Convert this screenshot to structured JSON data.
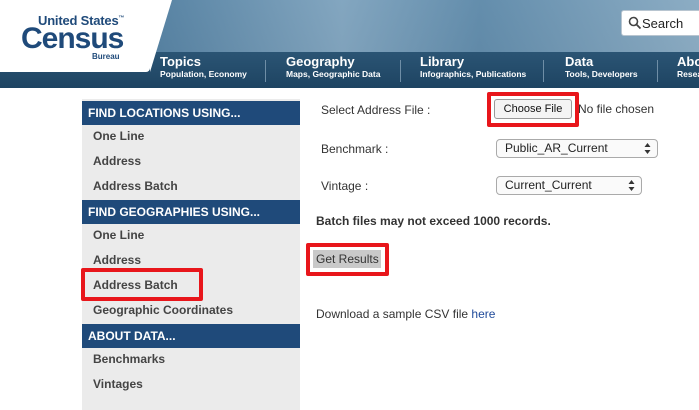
{
  "header": {
    "logo": {
      "line1": "United States",
      "tm": "™",
      "line2": "Census",
      "line3": "Bureau"
    },
    "search": {
      "label": "Search"
    },
    "nav": [
      {
        "title": "Topics",
        "sub": "Population, Economy"
      },
      {
        "title": "Geography",
        "sub": "Maps, Geographic Data"
      },
      {
        "title": "Library",
        "sub": "Infographics, Publications"
      },
      {
        "title": "Data",
        "sub": "Tools, Developers"
      },
      {
        "title": "Abo",
        "sub": "Resea"
      }
    ]
  },
  "sidebar": {
    "sections": [
      {
        "heading": "FIND LOCATIONS USING...",
        "items": [
          "One Line",
          "Address",
          "Address Batch"
        ]
      },
      {
        "heading": "FIND GEOGRAPHIES USING...",
        "items": [
          "One Line",
          "Address",
          "Address Batch",
          "Geographic Coordinates"
        ]
      },
      {
        "heading": "ABOUT DATA...",
        "items": [
          "Benchmarks",
          "Vintages"
        ]
      }
    ]
  },
  "form": {
    "address_file_label": "Select Address File :",
    "choose_file_button": "Choose File",
    "file_status": "No file chosen",
    "benchmark_label": "Benchmark :",
    "benchmark_value": "Public_AR_Current",
    "vintage_label": "Vintage :",
    "vintage_value": "Current_Current",
    "batch_note": "Batch files may not exceed 1000 records.",
    "get_results_button": "Get Results",
    "sample_text": "Download a sample CSV file",
    "sample_link": "here"
  },
  "colors": {
    "brand_blue": "#1f4a7a",
    "highlight_red": "#e8161b",
    "sidebar_bg": "#ebebeb"
  }
}
